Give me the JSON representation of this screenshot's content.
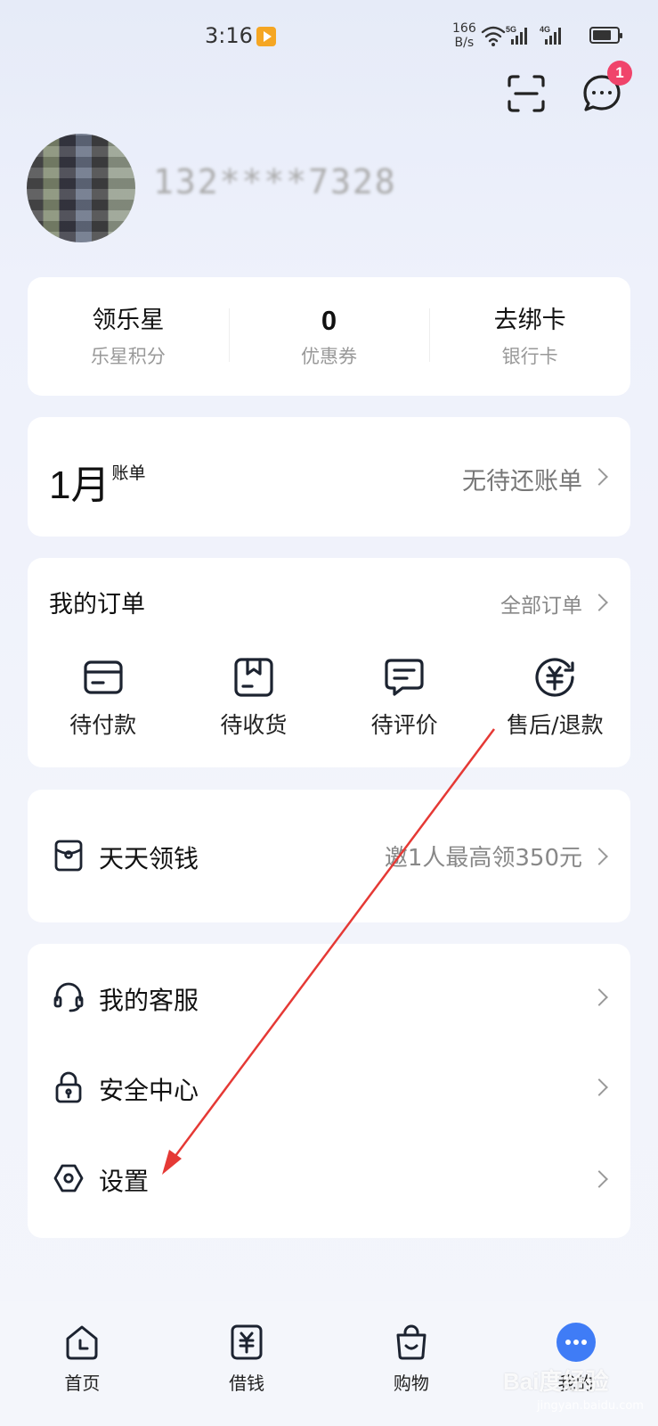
{
  "status_bar": {
    "time": "3:16",
    "net_speed_value": "166",
    "net_speed_unit": "B/s",
    "signal_1": "5G",
    "signal_2": "4G"
  },
  "header": {
    "message_badge_count": "1",
    "username": "132****7328"
  },
  "stats": [
    {
      "value": "领乐星",
      "label": "乐星积分"
    },
    {
      "value": "0",
      "label": "优惠券"
    },
    {
      "value": "去绑卡",
      "label": "银行卡"
    }
  ],
  "bill": {
    "month": "1月",
    "suffix": "账单",
    "status": "无待还账单"
  },
  "orders": {
    "title": "我的订单",
    "all_link": "全部订单",
    "items": [
      {
        "label": "待付款",
        "icon": "wallet-card-icon"
      },
      {
        "label": "待收货",
        "icon": "package-box-icon"
      },
      {
        "label": "待评价",
        "icon": "comment-icon"
      },
      {
        "label": "售后/退款",
        "icon": "refund-yuan-icon"
      }
    ]
  },
  "earn": {
    "label": "天天领钱",
    "extra": "邀1人最高领350元"
  },
  "menu": [
    {
      "label": "我的客服",
      "icon": "headset-icon"
    },
    {
      "label": "安全中心",
      "icon": "lock-icon"
    },
    {
      "label": "设置",
      "icon": "settings-hexagon-icon"
    }
  ],
  "tabs": [
    {
      "label": "首页",
      "icon": "home-clock-icon"
    },
    {
      "label": "借钱",
      "icon": "loan-yuan-icon"
    },
    {
      "label": "购物",
      "icon": "shopping-bag-icon"
    },
    {
      "label": "我的",
      "icon": "profile-dots-icon",
      "active": true
    }
  ],
  "watermark": {
    "text": "Bai度经验",
    "sub": "jingyan.baidu.com"
  },
  "colors": {
    "accent": "#3f7cf6",
    "badge": "#f0446b",
    "annotation_arrow": "#e53935"
  }
}
